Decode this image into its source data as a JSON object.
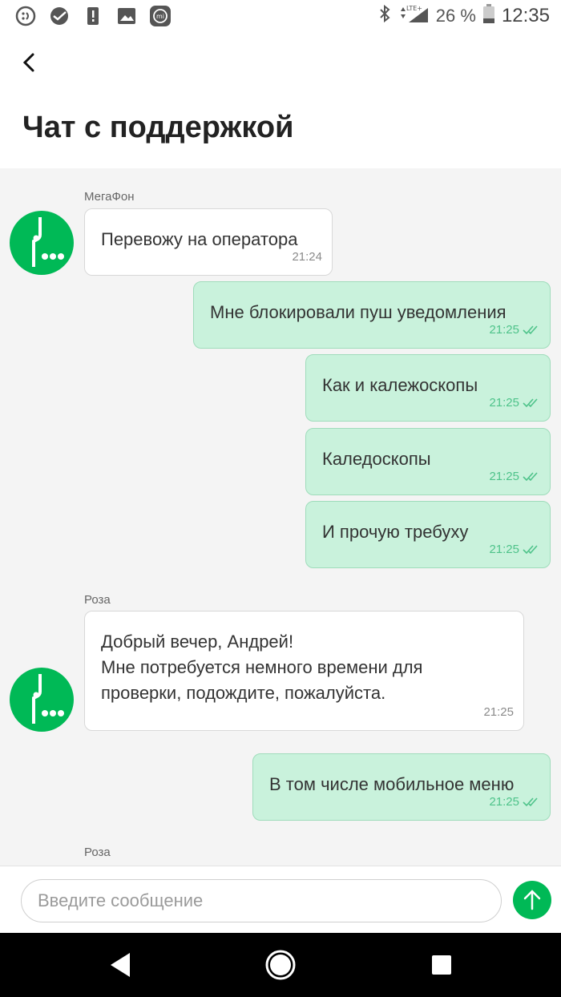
{
  "status_bar": {
    "left_icons": [
      "message-icon",
      "sber-icon",
      "alert-icon",
      "image-icon",
      "mi-icon"
    ],
    "battery_percent": "26 %",
    "time": "12:35",
    "network": "LTE+"
  },
  "header": {
    "title": "Чат с поддержкой"
  },
  "chat": {
    "groups": [
      {
        "sender": "МегаФон",
        "text": "Перевожу на оператора",
        "time": "21:24"
      },
      {
        "sender": "Роза",
        "text": "Добрый вечер, Андрей!\nМне потребуется немного времени для проверки, подождите, пожалуйста.",
        "time": "21:25"
      },
      {
        "sender": "Роза"
      }
    ],
    "outgoing": [
      {
        "text": "Мне блокировали пуш уведомления",
        "time": "21:25"
      },
      {
        "text": "Как и калежоскопы",
        "time": "21:25"
      },
      {
        "text": "Каледоскопы",
        "time": "21:25"
      },
      {
        "text": "И прочую требуху",
        "time": "21:25"
      },
      {
        "text": "В том числе мобильное меню",
        "time": "21:25"
      }
    ]
  },
  "composer": {
    "placeholder": "Введите сообщение"
  },
  "colors": {
    "brand_green": "#00b956",
    "outgoing_bubble": "#c9f2dc",
    "read_check": "#4ec38a"
  }
}
